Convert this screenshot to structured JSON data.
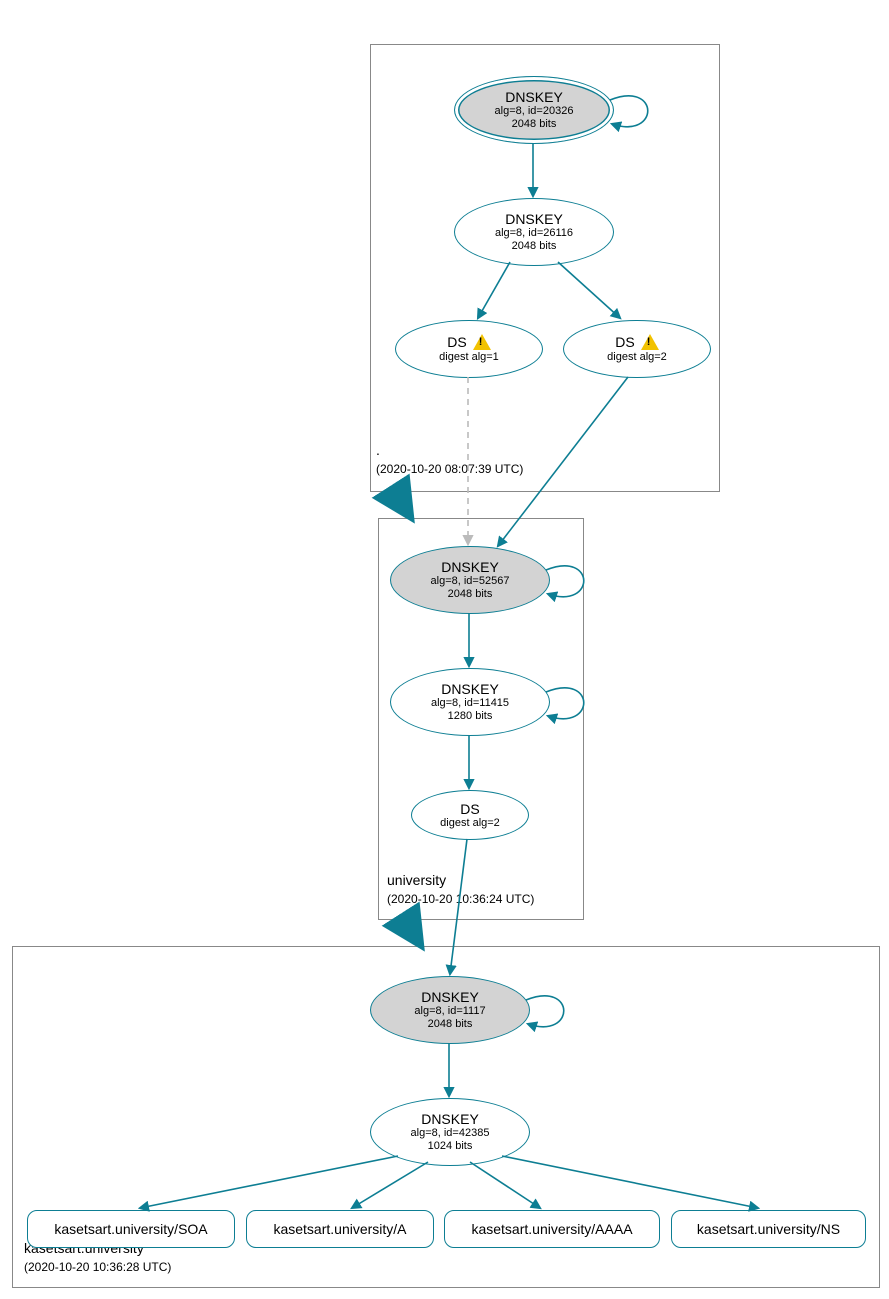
{
  "zones": {
    "root": {
      "label": ".",
      "timestamp": "(2020-10-20 08:07:39 UTC)"
    },
    "university": {
      "label": "university",
      "timestamp": "(2020-10-20 10:36:24 UTC)"
    },
    "kasetsart": {
      "label": "kasetsart.university",
      "timestamp": "(2020-10-20 10:36:28 UTC)"
    }
  },
  "nodes": {
    "root_ksk": {
      "title": "DNSKEY",
      "line2": "alg=8, id=20326",
      "line3": "2048 bits"
    },
    "root_zsk": {
      "title": "DNSKEY",
      "line2": "alg=8, id=26116",
      "line3": "2048 bits"
    },
    "root_ds1": {
      "title": "DS",
      "line2": "digest alg=1",
      "warn": true
    },
    "root_ds2": {
      "title": "DS",
      "line2": "digest alg=2",
      "warn": true
    },
    "univ_ksk": {
      "title": "DNSKEY",
      "line2": "alg=8, id=52567",
      "line3": "2048 bits"
    },
    "univ_zsk": {
      "title": "DNSKEY",
      "line2": "alg=8, id=11415",
      "line3": "1280 bits"
    },
    "univ_ds": {
      "title": "DS",
      "line2": "digest alg=2"
    },
    "kaset_ksk": {
      "title": "DNSKEY",
      "line2": "alg=8, id=1117",
      "line3": "2048 bits"
    },
    "kaset_zsk": {
      "title": "DNSKEY",
      "line2": "alg=8, id=42385",
      "line3": "1024 bits"
    },
    "rr_soa": {
      "title": "kasetsart.university/SOA"
    },
    "rr_a": {
      "title": "kasetsart.university/A"
    },
    "rr_aaaa": {
      "title": "kasetsart.university/AAAA"
    },
    "rr_ns": {
      "title": "kasetsart.university/NS"
    }
  },
  "colors": {
    "stroke": "#0d7e93"
  }
}
